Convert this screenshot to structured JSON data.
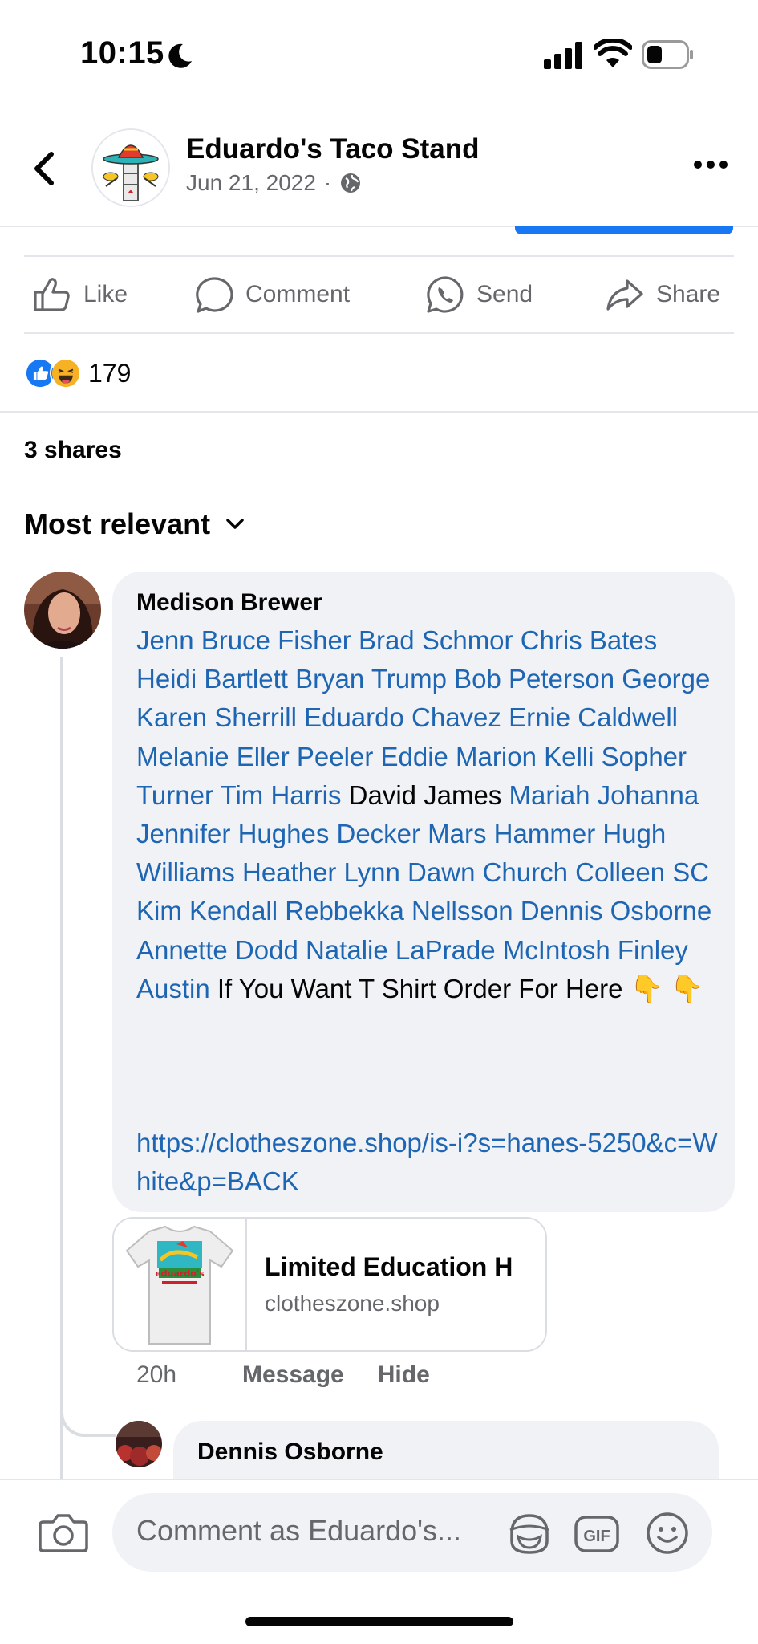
{
  "status_bar": {
    "time": "10:15"
  },
  "header": {
    "page_name": "Eduardo's Taco Stand",
    "post_date": "Jun 21, 2022",
    "separator": "·"
  },
  "actions": {
    "like": "Like",
    "comment": "Comment",
    "send": "Send",
    "share": "Share"
  },
  "reactions": {
    "count": "179"
  },
  "shares": "3 shares",
  "sort": {
    "label": "Most relevant"
  },
  "comment": {
    "author": "Medison Brewer",
    "body_segments": [
      {
        "text": "Jenn Bruce Fisher Brad Schmor Chris Bates Heidi Bartlett Bryan Trump Bob Peterson George Karen Sherrill Eduardo Chavez Ernie Caldwell Melanie Eller Peeler Eddie Marion Kelli Sopher Turner Tim Harris",
        "mention": true
      },
      {
        "text": " David James ",
        "mention": false
      },
      {
        "text": "Mariah Johanna Jennifer Hughes Decker Mars Hammer Hugh Williams Heather Lynn Dawn Church Colleen SC Kim Kendall Rebbekka Nellsson Dennis Osborne Annette Dodd Natalie LaPrade McIntosh Finley Austin",
        "mention": true
      },
      {
        "text": " If You Want T Shirt Order For Here 👇 👇",
        "mention": false
      }
    ],
    "link": "https://clotheszone.shop/is-i?s=hanes-5250&c=White&p=BACK",
    "preview": {
      "title": "Limited Education H",
      "domain": "clotheszone.shop",
      "thumb_text": "eduardo's"
    },
    "time": "20h",
    "message_label": "Message",
    "hide_label": "Hide"
  },
  "reply": {
    "author": "Dennis Osborne"
  },
  "composer": {
    "placeholder": "Comment as Eduardo's...",
    "gif_label": "GIF"
  },
  "colors": {
    "accent": "#1877f2",
    "mention": "#1e66b3",
    "muted": "#65676b",
    "bubble": "#f0f2f5"
  }
}
